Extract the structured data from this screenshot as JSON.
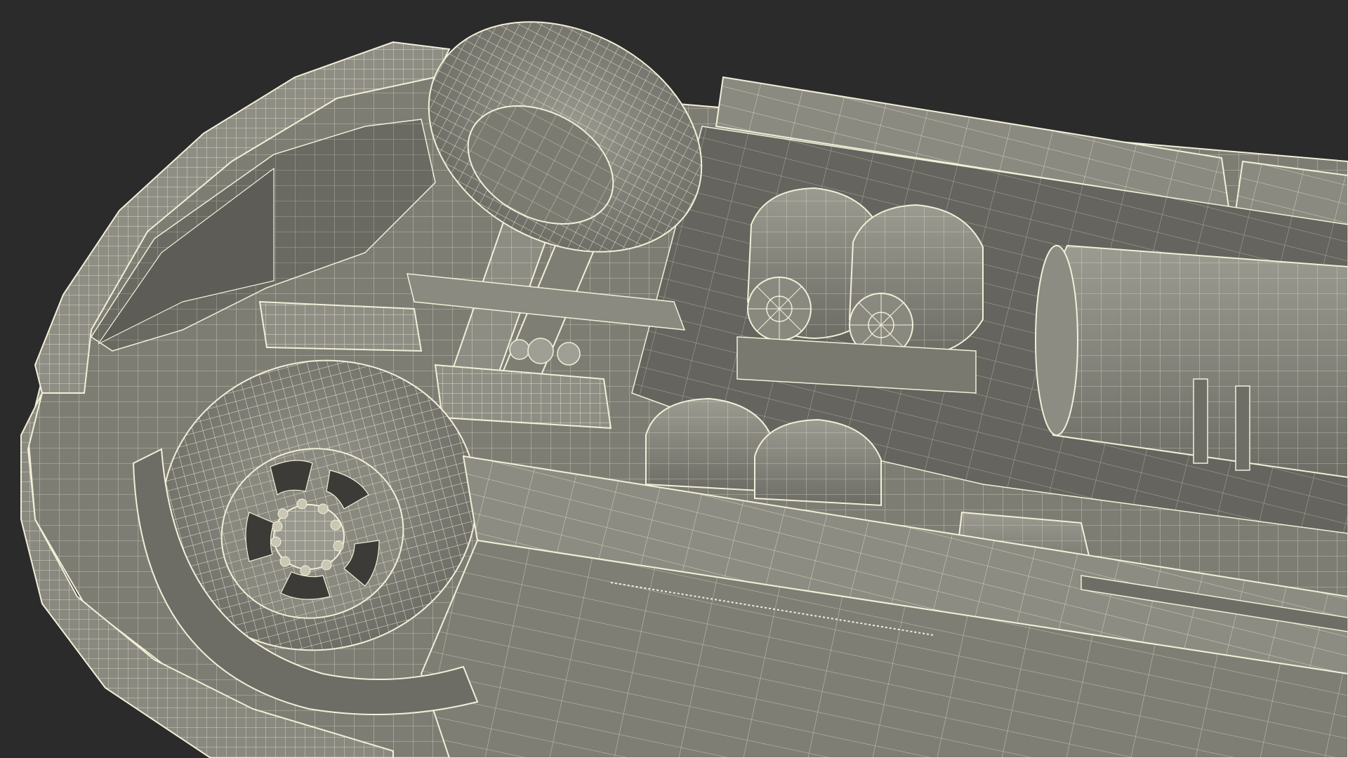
{
  "render": {
    "background_color": "#2b2b2b",
    "surface_fill": "#8d8c82",
    "surface_shade": "#6f6e66",
    "surface_dark": "#55544e",
    "wire_color": "#f2efd8",
    "subject": "wireframe-3d-vehicle-undercarriage"
  }
}
